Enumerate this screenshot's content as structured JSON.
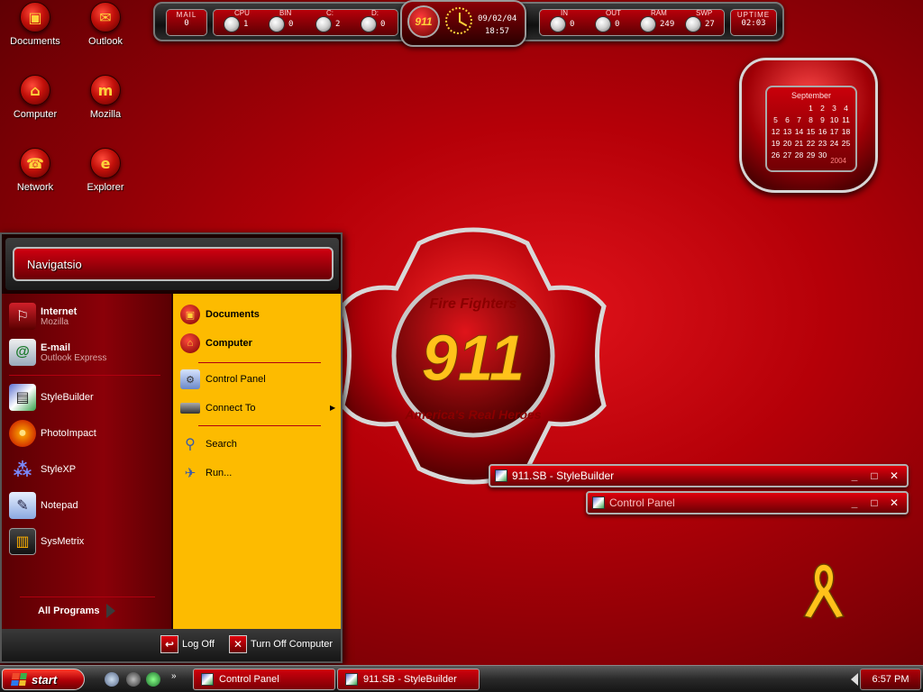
{
  "desktop": {
    "icons": [
      {
        "label": "Documents",
        "glyph": "▣"
      },
      {
        "label": "Outlook",
        "glyph": "✉"
      },
      {
        "label": "Computer",
        "glyph": "⌂"
      },
      {
        "label": "Mozilla",
        "glyph": "m"
      },
      {
        "label": "Network",
        "glyph": "☎"
      },
      {
        "label": "Explorer",
        "glyph": "e"
      }
    ]
  },
  "monitor": {
    "mail": {
      "label": "MAIL",
      "value": "0"
    },
    "cpu": {
      "label": "CPU",
      "value": "1"
    },
    "bin": {
      "label": "BIN",
      "value": "0"
    },
    "c": {
      "label": "C:",
      "value": "2"
    },
    "d": {
      "label": "D:",
      "value": "0"
    },
    "logo": "911",
    "date": "09/02/04",
    "time": "18:57",
    "in": {
      "label": "IN",
      "value": "0"
    },
    "out": {
      "label": "OUT",
      "value": "0"
    },
    "ram": {
      "label": "RAM",
      "value": "249"
    },
    "swp": {
      "label": "SWP",
      "value": "27"
    },
    "uptime": {
      "label": "UPTIME",
      "value": "02:03"
    }
  },
  "calendar": {
    "month": "September",
    "year": "2004",
    "days": [
      "",
      "",
      "",
      "1",
      "2",
      "3",
      "4",
      "5",
      "6",
      "7",
      "8",
      "9",
      "10",
      "11",
      "12",
      "13",
      "14",
      "15",
      "16",
      "17",
      "18",
      "19",
      "20",
      "21",
      "22",
      "23",
      "24",
      "25",
      "26",
      "27",
      "28",
      "29",
      "30"
    ]
  },
  "emblem": {
    "top_text": "Fire Fighters",
    "number": "911",
    "bottom_text": "America's Real Heroes"
  },
  "start_menu": {
    "header": "Navigatsio",
    "pinned": [
      {
        "title": "Internet",
        "subtitle": "Mozilla",
        "glyph": "⚐"
      },
      {
        "title": "E-mail",
        "subtitle": "Outlook Express",
        "glyph": "@"
      }
    ],
    "recent": [
      {
        "title": "StyleBuilder",
        "glyph": "▤"
      },
      {
        "title": "PhotoImpact",
        "glyph": "●"
      },
      {
        "title": "StyleXP",
        "glyph": "⁂"
      },
      {
        "title": "Notepad",
        "glyph": "✎"
      },
      {
        "title": "SysMetrix",
        "glyph": "▥"
      }
    ],
    "all_programs": "All Programs",
    "right": {
      "documents": "Documents",
      "computer": "Computer",
      "control_panel": "Control Panel",
      "connect_to": "Connect To",
      "search": "Search",
      "run": "Run..."
    },
    "log_off": "Log Off",
    "turn_off": "Turn Off Computer"
  },
  "windows": [
    {
      "title": "911.SB - StyleBuilder"
    },
    {
      "title": "Control Panel"
    }
  ],
  "taskbar": {
    "start": "start",
    "buttons": [
      {
        "label": "Control Panel"
      },
      {
        "label": "911.SB - StyleBuilder"
      }
    ],
    "clock": "6:57 PM",
    "chevron": "»"
  },
  "colors": {
    "accent_red": "#c2000a",
    "menu_yellow": "#fdbb00",
    "logo_yellow": "#ffd23a"
  }
}
